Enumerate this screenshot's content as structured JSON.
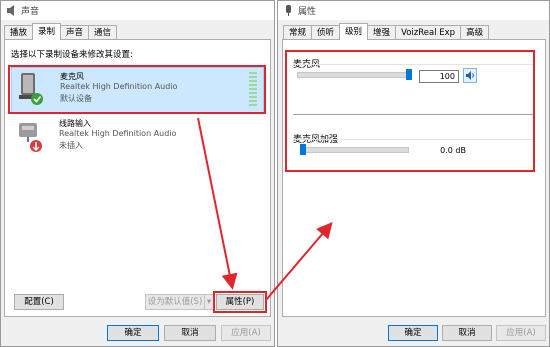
{
  "left": {
    "title": "声音",
    "tabs": [
      "播放",
      "录制",
      "声音",
      "通信"
    ],
    "instruction": "选择以下录制设备来修改其设置:",
    "devices": [
      {
        "name": "麦克风",
        "driver": "Realtek High Definition Audio",
        "status": "默认设备"
      },
      {
        "name": "线路输入",
        "driver": "Realtek High Definition Audio",
        "status": "未插入"
      }
    ],
    "configure_label": "配置(C)",
    "set_default_label": "设为默认值(S)",
    "set_default_arrow": "▾",
    "properties_label": "属性(P)",
    "ok_label": "确定",
    "cancel_label": "取消",
    "apply_label": "应用(A)"
  },
  "right": {
    "title": "属性",
    "tabs": [
      "常规",
      "侦听",
      "级别",
      "增强",
      "VoizReal Exp",
      "高级"
    ],
    "mic_label": "麦克风",
    "mic_value": "100",
    "mic_level": 1.0,
    "boost_label": "麦克风加强",
    "boost_value": "0.0 dB",
    "boost_level": 0.0,
    "ok_label": "确定",
    "cancel_label": "取消",
    "apply_label": "应用(A)"
  },
  "colors": {
    "highlight_red": "#e0262c",
    "accent_blue": "#0078d7",
    "selection_bg": "#cce8ff"
  }
}
